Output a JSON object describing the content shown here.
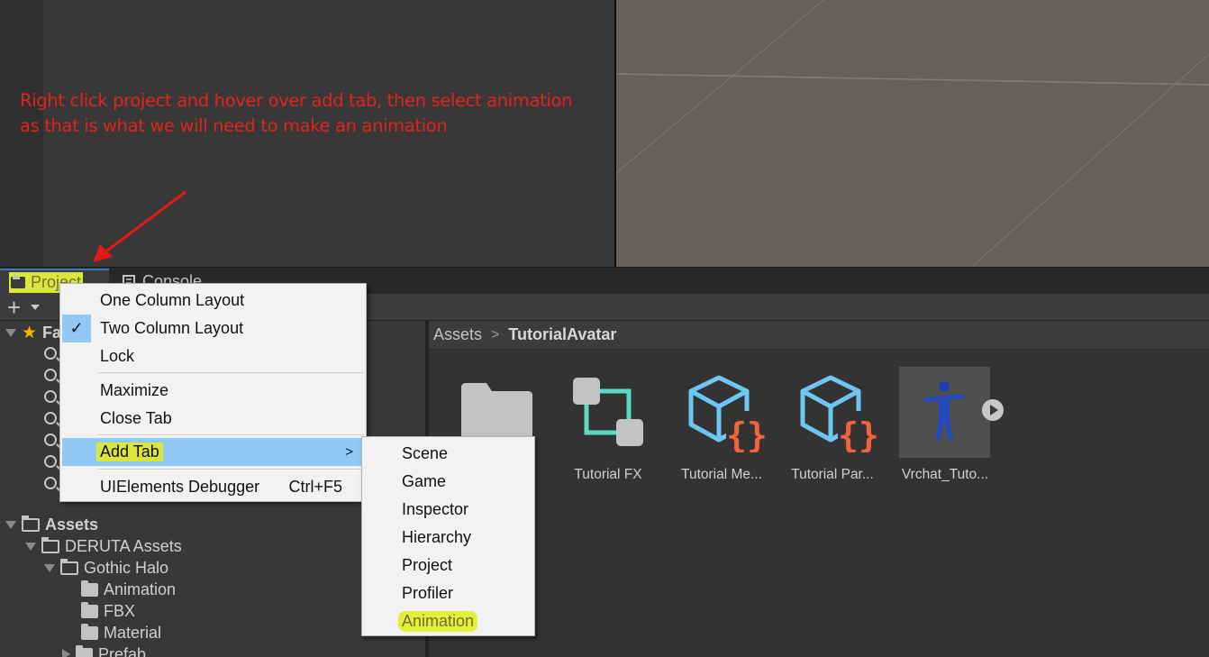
{
  "annotation": {
    "line1": "Right click project and hover over add tab, then select animation",
    "line2": "as that is what we will need to make an animation"
  },
  "tabs": {
    "project": "Project",
    "console": "Console"
  },
  "tree": {
    "favorites": "Fa",
    "assets": "Assets",
    "deruta": "DERUTA Assets",
    "gothic": "Gothic Halo",
    "animation": "Animation",
    "fbx": "FBX",
    "material": "Material",
    "prefab": "Prefab"
  },
  "breadcrumb": {
    "root": "Assets",
    "separator": ">",
    "current": "TutorialAvatar"
  },
  "assets": [
    {
      "label": "Tutorial FX",
      "icon": "animator-controller-icon"
    },
    {
      "label": "Tutorial Me...",
      "icon": "menu-asset-icon"
    },
    {
      "label": "Tutorial Par...",
      "icon": "parameters-asset-icon"
    },
    {
      "label": "Vrchat_Tuto...",
      "icon": "avatar-model-icon"
    }
  ],
  "context_menu": {
    "items": [
      {
        "label": "One Column Layout"
      },
      {
        "label": "Two Column Layout",
        "checked": true
      },
      {
        "label": "Lock"
      },
      {
        "label": "Maximize"
      },
      {
        "label": "Close Tab"
      },
      {
        "label": "Add Tab",
        "submenu": true,
        "highlighted": true
      },
      {
        "label": "UIElements Debugger",
        "shortcut": "Ctrl+F5"
      }
    ],
    "check_mark": "✓",
    "submenu_arrow": ">"
  },
  "add_tab_submenu": {
    "items": [
      "Scene",
      "Game",
      "Inspector",
      "Hierarchy",
      "Project",
      "Profiler",
      "Animation"
    ]
  },
  "colors": {
    "annotation": "#e0241c",
    "highlighter": "#dbe63c",
    "menu_highlight": "#90c8f6",
    "tab_accent": "#3a79bb"
  }
}
